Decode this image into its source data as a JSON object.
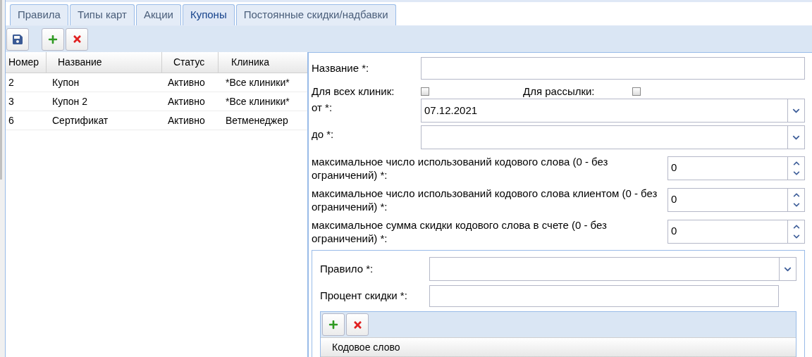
{
  "tabs": [
    {
      "label": "Правила",
      "selected": false
    },
    {
      "label": "Типы карт",
      "selected": false
    },
    {
      "label": "Акции",
      "selected": false
    },
    {
      "label": "Купоны",
      "selected": true
    },
    {
      "label": "Постоянные скидки/надбавки",
      "selected": false
    }
  ],
  "table": {
    "columns": [
      "Номер",
      "Название",
      "Статус",
      "Клиника"
    ],
    "rows": [
      [
        "2",
        "Купон",
        "Активно",
        "*Все клиники*"
      ],
      [
        "3",
        "Купон 2",
        "Активно",
        "*Все клиники*"
      ],
      [
        "6",
        "Сертификат",
        "Активно",
        "Ветменеджер"
      ]
    ]
  },
  "form": {
    "name_label": "Название *:",
    "checkboxes": [
      {
        "label": "Для всех клиник:",
        "checked": false
      },
      {
        "label": "Для рассылки:",
        "checked": false
      }
    ],
    "from": {
      "label": "от *:",
      "value": "07.12.2021"
    },
    "to": {
      "label": "до *:"
    },
    "numbers": [
      {
        "label": "максимальное число использований кодового слова (0 - без ограничений) *:",
        "value": "0"
      },
      {
        "label": "максимальное число использований кодового слова клиентом (0 - без ограничений) *:",
        "value": "0"
      },
      {
        "label": "максимальное сумма скидки кодового слова в счете (0 - без ограничений) *:",
        "value": "0"
      }
    ],
    "rule": {
      "label": "Правило *:"
    },
    "percent": {
      "label": "Процент скидки *:"
    },
    "codewords": {
      "columns": [
        "Кодовое слово"
      ]
    }
  }
}
